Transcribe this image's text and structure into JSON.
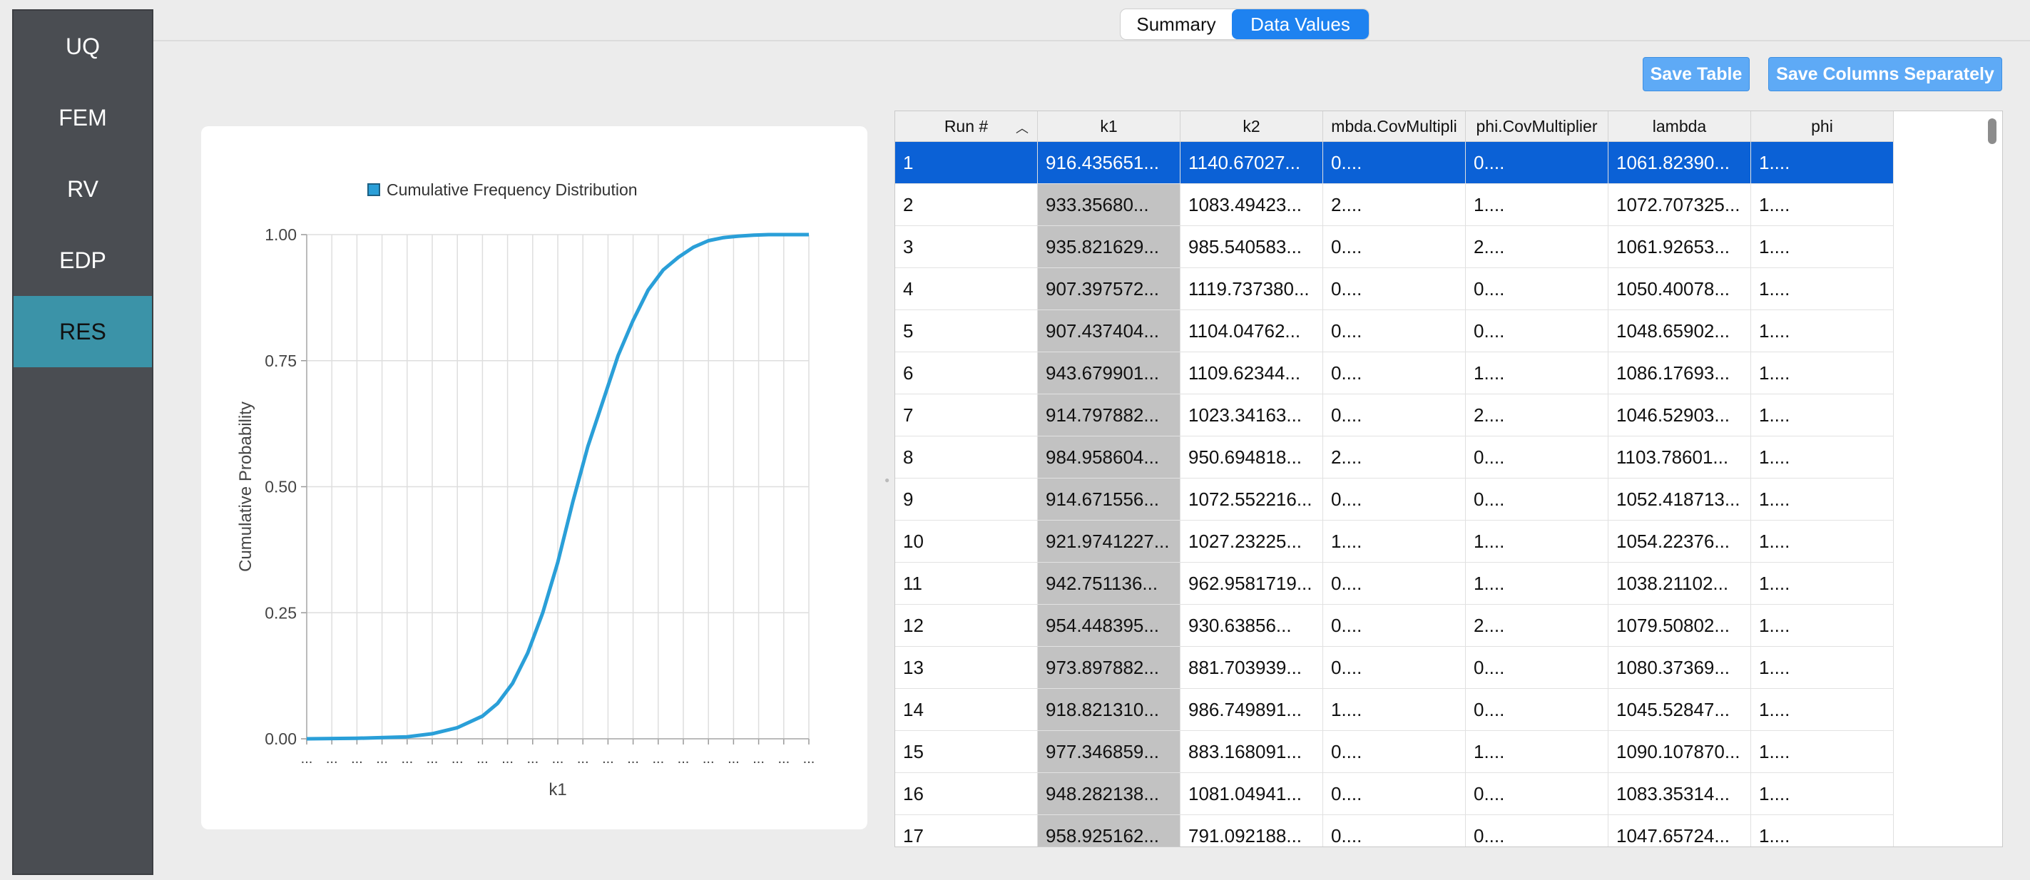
{
  "sidebar": {
    "items": [
      {
        "label": "UQ",
        "active": false
      },
      {
        "label": "FEM",
        "active": false
      },
      {
        "label": "RV",
        "active": false
      },
      {
        "label": "EDP",
        "active": false
      },
      {
        "label": "RES",
        "active": true
      }
    ]
  },
  "tabs": [
    {
      "label": "Summary",
      "selected": false
    },
    {
      "label": "Data Values",
      "selected": true
    }
  ],
  "toolbar": {
    "save_table_label": "Save Table",
    "save_columns_label": "Save Columns Separately"
  },
  "chart_data": {
    "type": "line",
    "legend": "Cumulative Frequency Distribution",
    "xlabel": "k1",
    "ylabel": "Cumulative Probability",
    "ylim": [
      0,
      1
    ],
    "yticks": [
      "0.00",
      "0.25",
      "0.50",
      "0.75",
      "1.00"
    ],
    "xtick_label": "...",
    "xtick_count": 21,
    "grid": true,
    "series_color": "#2a9fd8",
    "series": [
      {
        "x": [
          0,
          0.1,
          0.2,
          0.25,
          0.3,
          0.35,
          0.38,
          0.41,
          0.44,
          0.47,
          0.5,
          0.53,
          0.56,
          0.59,
          0.62,
          0.65,
          0.68,
          0.71,
          0.74,
          0.77,
          0.8,
          0.83,
          0.86,
          0.89,
          0.92,
          0.95,
          1.0
        ],
        "y": [
          0,
          0.001,
          0.004,
          0.01,
          0.022,
          0.045,
          0.07,
          0.11,
          0.17,
          0.25,
          0.35,
          0.47,
          0.58,
          0.67,
          0.76,
          0.83,
          0.89,
          0.93,
          0.955,
          0.975,
          0.988,
          0.994,
          0.997,
          0.999,
          1.0,
          1.0,
          1.0
        ]
      }
    ]
  },
  "table": {
    "columns": [
      "Run #",
      "k1",
      "k2",
      "mbda.CovMultipli",
      "phi.CovMultiplier",
      "lambda",
      "phi"
    ],
    "sorted_column": "Run #",
    "selected_row": 0,
    "rows": [
      [
        "1",
        "916.435651...",
        "1140.67027...",
        "0....",
        "0....",
        "1061.82390...",
        "1...."
      ],
      [
        "2",
        "933.35680...",
        "1083.49423...",
        "2....",
        "1....",
        "1072.707325...",
        "1...."
      ],
      [
        "3",
        "935.821629...",
        "985.540583...",
        "0....",
        "2....",
        "1061.92653...",
        "1...."
      ],
      [
        "4",
        "907.397572...",
        "1119.737380...",
        "0....",
        "0....",
        "1050.40078...",
        "1...."
      ],
      [
        "5",
        "907.437404...",
        "1104.04762...",
        "0....",
        "0....",
        "1048.65902...",
        "1...."
      ],
      [
        "6",
        "943.679901...",
        "1109.62344...",
        "0....",
        "1....",
        "1086.17693...",
        "1...."
      ],
      [
        "7",
        "914.797882...",
        "1023.34163...",
        "0....",
        "2....",
        "1046.52903...",
        "1...."
      ],
      [
        "8",
        "984.958604...",
        "950.694818...",
        "2....",
        "0....",
        "1103.78601...",
        "1...."
      ],
      [
        "9",
        "914.671556...",
        "1072.552216...",
        "0....",
        "0....",
        "1052.418713...",
        "1...."
      ],
      [
        "10",
        "921.9741227...",
        "1027.23225...",
        "1....",
        "1....",
        "1054.22376...",
        "1...."
      ],
      [
        "11",
        "942.751136...",
        "962.9581719...",
        "0....",
        "1....",
        "1038.21102...",
        "1...."
      ],
      [
        "12",
        "954.448395...",
        "930.63856...",
        "0....",
        "2....",
        "1079.50802...",
        "1...."
      ],
      [
        "13",
        "973.897882...",
        "881.703939...",
        "0....",
        "0....",
        "1080.37369...",
        "1...."
      ],
      [
        "14",
        "918.821310...",
        "986.749891...",
        "1....",
        "0....",
        "1045.52847...",
        "1...."
      ],
      [
        "15",
        "977.346859...",
        "883.168091...",
        "0....",
        "1....",
        "1090.107870...",
        "1...."
      ],
      [
        "16",
        "948.282138...",
        "1081.04941...",
        "0....",
        "0....",
        "1083.35314...",
        "1...."
      ],
      [
        "17",
        "958.925162...",
        "791.092188...",
        "0....",
        "0....",
        "1047.65724...",
        "1...."
      ]
    ]
  }
}
